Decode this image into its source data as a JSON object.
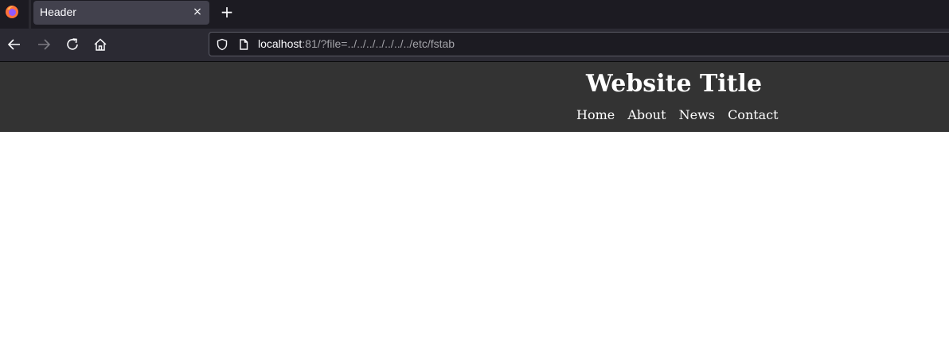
{
  "browser": {
    "tab": {
      "title": "Header",
      "close_symbol": "×"
    },
    "new_tab_symbol": "+",
    "url": {
      "host": "localhost",
      "rest": ":81/?file=../../../../../../../etc/fstab"
    }
  },
  "page": {
    "title": "Website Title",
    "nav": [
      "Home",
      "About",
      "News",
      "Contact"
    ]
  },
  "colors": {
    "tabbar_bg": "#1c1b22",
    "active_tab_bg": "#42414d",
    "toolbar_bg": "#2b2a33",
    "header_bg": "#333333",
    "page_bg": "#ffffff"
  }
}
